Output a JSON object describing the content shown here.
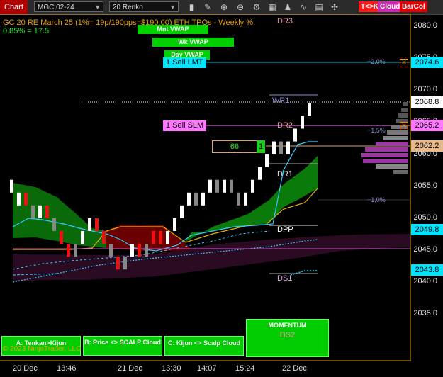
{
  "toolbar": {
    "window_label": "Chart",
    "instrument": "MGC 02-24",
    "bar_type": "20 Renko",
    "badges": [
      {
        "label": "T<>K",
        "color": "#ff1a1a"
      },
      {
        "label": "Cloud",
        "color": "#cc2bb0"
      },
      {
        "label": "BarCol",
        "color": "#e00000"
      }
    ],
    "icons": [
      "bar-style-icon",
      "drawing-tools-icon",
      "zoom-in-icon",
      "zoom-out-icon",
      "properties-icon",
      "data-box-icon",
      "strategies-icon",
      "indicators-icon",
      "template-icon",
      "crosshair-icon"
    ]
  },
  "header": {
    "line1": "GC 20 RE March 25 (1%= 19p/190pps=$190.00)  ETH TPOs - Weekly %",
    "line2": "0.85% = 17.5"
  },
  "vwap_labels": {
    "month": "Mnt VWAP",
    "week": "Wk VWAP",
    "day": "Day VWAP"
  },
  "orders": {
    "sell_limit": {
      "label": "1 Sell LMT",
      "price": "2074.6",
      "pct": "+2,0%"
    },
    "sell_stop": {
      "label": "1 Sell SLM",
      "price": "2065.2",
      "pct": "+1,5%"
    },
    "position": {
      "qty": "66",
      "qty2": "1",
      "price": "2062.2"
    },
    "pct_1": "+1,0%"
  },
  "levels": {
    "dr3": "DR3",
    "wr1": "WR1",
    "dr2": "DR2",
    "dr1": "DR1",
    "dpp": "DPP",
    "ds1": "DS1",
    "ds2": "DS2"
  },
  "price_axis": {
    "ticks": [
      "2080.0",
      "2075.0",
      "2070.0",
      "2065.0",
      "2060.0",
      "2055.0",
      "2050.0",
      "2045.0",
      "2040.0",
      "2035.0"
    ],
    "last_price": "2068.8",
    "tag_2049": "2049.8",
    "tag_2043": "2043.8"
  },
  "time_axis": [
    "20 Dec",
    "13:46",
    "21 Dec",
    "13:30",
    "14:07",
    "15:24",
    "22 Dec"
  ],
  "buttons": {
    "tenkan": "A: Tenkan>Kijun",
    "scalp": "B: Price <> SCALP Cloud",
    "kijun": "C: Kijun <> Scalp Cloud",
    "momentum": "MOMENTUM"
  },
  "copyright": "© 2023 NinjaTrader, LLC",
  "colors": {
    "up_bar": "#ffffff",
    "down_bar": "#ee1111",
    "neutral_bar": "#888888",
    "cloud_bull": "#007a00",
    "cloud_bear": "#7a0000",
    "cloud_pink": "#3a1030",
    "tenkan": "#33ccff",
    "kijun": "#e8b000",
    "accent_cyan": "#00e5ff",
    "accent_magenta": "#ff66ff"
  },
  "bars": [
    {
      "t": "u",
      "o": 2054,
      "c": 2056
    },
    {
      "t": "u",
      "o": 2052,
      "c": 2054
    },
    {
      "t": "d",
      "o": 2054,
      "c": 2052
    },
    {
      "t": "n",
      "o": 2052,
      "c": 2050
    },
    {
      "t": "u",
      "o": 2050,
      "c": 2052
    },
    {
      "t": "d",
      "o": 2052,
      "c": 2050
    },
    {
      "t": "n",
      "o": 2050,
      "c": 2048
    },
    {
      "t": "d",
      "o": 2048,
      "c": 2046
    },
    {
      "t": "d",
      "o": 2046,
      "c": 2044
    },
    {
      "t": "n",
      "o": 2044,
      "c": 2046
    },
    {
      "t": "u",
      "o": 2046,
      "c": 2048
    },
    {
      "t": "u",
      "o": 2048,
      "c": 2050
    },
    {
      "t": "d",
      "o": 2050,
      "c": 2048
    },
    {
      "t": "d",
      "o": 2048,
      "c": 2046
    },
    {
      "t": "n",
      "o": 2046,
      "c": 2044
    },
    {
      "t": "d",
      "o": 2044,
      "c": 2042
    },
    {
      "t": "n",
      "o": 2042,
      "c": 2044
    },
    {
      "t": "u",
      "o": 2044,
      "c": 2046
    },
    {
      "t": "d",
      "o": 2046,
      "c": 2044
    },
    {
      "t": "n",
      "o": 2044,
      "c": 2046
    },
    {
      "t": "d",
      "o": 2046,
      "c": 2048
    },
    {
      "t": "d",
      "o": 2048,
      "c": 2046
    },
    {
      "t": "u",
      "o": 2046,
      "c": 2048
    },
    {
      "t": "u",
      "o": 2048,
      "c": 2050
    },
    {
      "t": "u",
      "o": 2050,
      "c": 2052
    },
    {
      "t": "u",
      "o": 2052,
      "c": 2054
    },
    {
      "t": "n",
      "o": 2054,
      "c": 2052
    },
    {
      "t": "u",
      "o": 2052,
      "c": 2054
    },
    {
      "t": "u",
      "o": 2054,
      "c": 2056
    },
    {
      "t": "n",
      "o": 2056,
      "c": 2054
    },
    {
      "t": "u",
      "o": 2054,
      "c": 2056
    },
    {
      "t": "n",
      "o": 2056,
      "c": 2054
    },
    {
      "t": "n",
      "o": 2054,
      "c": 2052
    },
    {
      "t": "u",
      "o": 2052,
      "c": 2054
    },
    {
      "t": "u",
      "o": 2054,
      "c": 2056
    },
    {
      "t": "u",
      "o": 2056,
      "c": 2058
    },
    {
      "t": "u",
      "o": 2058,
      "c": 2060
    },
    {
      "t": "u",
      "o": 2060,
      "c": 2062
    },
    {
      "t": "n",
      "o": 2062,
      "c": 2060
    },
    {
      "t": "u",
      "o": 2060,
      "c": 2062
    },
    {
      "t": "u",
      "o": 2062,
      "c": 2064
    },
    {
      "t": "u",
      "o": 2064,
      "c": 2066
    },
    {
      "t": "u",
      "o": 2066,
      "c": 2068
    }
  ]
}
